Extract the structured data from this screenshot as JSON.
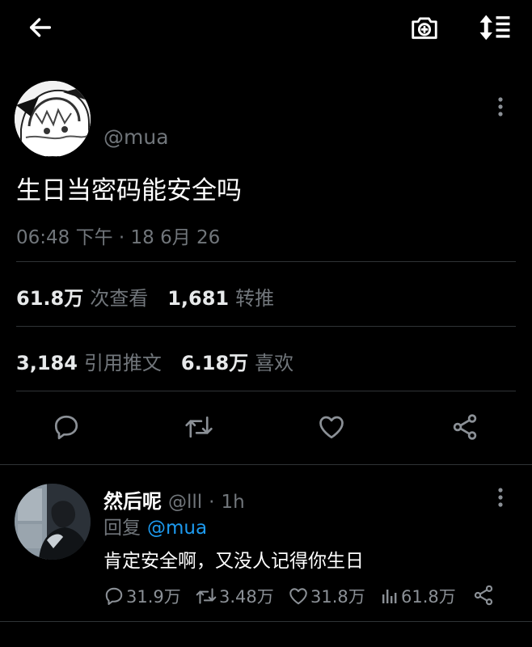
{
  "header": {
    "back_icon": "arrow-left-icon",
    "camera_icon": "camera-plus-icon",
    "sort_icon": "sort-list-icon"
  },
  "tweet": {
    "handle": "@mua",
    "text": "生日当密码能安全吗",
    "timestamp": "06:48 下午 · 18 6月 26",
    "views_count": "61.8万",
    "views_label": "次查看",
    "retweets_count": "1,681",
    "retweets_label": "转推",
    "quotes_count": "3,184",
    "quotes_label": "引用推文",
    "likes_count": "6.18万",
    "likes_label": "喜欢"
  },
  "reply": {
    "name": "然后呢",
    "handle": "@lll",
    "dot": "·",
    "time": "1h",
    "replying_label": "回复",
    "replying_to": "@mua",
    "text": "肯定安全啊，又没人记得你生日",
    "metrics": {
      "replies": "31.9万",
      "retweets": "3.48万",
      "likes": "31.8万",
      "views": "61.8万"
    }
  },
  "colors": {
    "background": "#000000",
    "text": "#e7e9ea",
    "muted": "#71767b",
    "link": "#1d9bf0",
    "divider": "#2f3336"
  }
}
